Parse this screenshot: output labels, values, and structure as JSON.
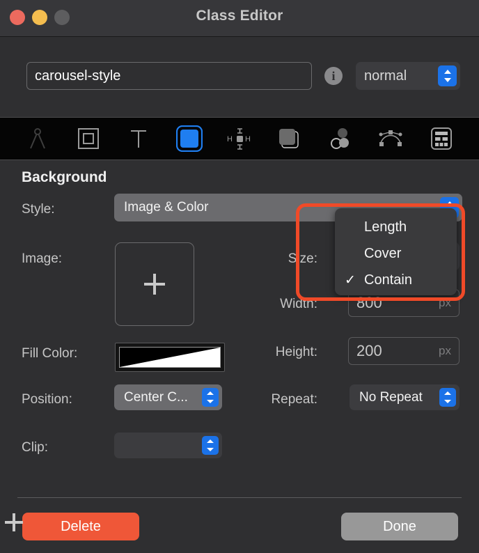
{
  "window": {
    "title": "Class Editor",
    "traffic_lights": [
      "close-button",
      "minimize-button",
      "zoom-button"
    ]
  },
  "name_row": {
    "class_name_value": "carousel-style",
    "class_name_placeholder": "",
    "info_icon": "info-icon",
    "state_value": "normal"
  },
  "toolbar": {
    "items": [
      {
        "name": "layout-compass-icon",
        "selected": false
      },
      {
        "name": "border-box-icon",
        "selected": false
      },
      {
        "name": "typography-icon",
        "selected": false
      },
      {
        "name": "background-fill-icon",
        "selected": true
      },
      {
        "name": "spacing-margins-icon",
        "selected": false
      },
      {
        "name": "shadow-layers-icon",
        "selected": false
      },
      {
        "name": "effects-blend-icon",
        "selected": false
      },
      {
        "name": "transition-curve-icon",
        "selected": false
      },
      {
        "name": "grid-table-icon",
        "selected": false
      }
    ]
  },
  "background": {
    "section_title": "Background",
    "style_label": "Style:",
    "style_value": "Image & Color",
    "image_label": "Image:",
    "image_add_glyph": "plus-icon",
    "fill_color_label": "Fill Color:",
    "fill_color_swatch": "black-to-white-diagonal",
    "position_label": "Position:",
    "position_value": "Center C...",
    "clip_label": "Clip:",
    "clip_value": "",
    "size_label": "Size:",
    "width_label": "Width:",
    "width_value": "800",
    "width_unit": "px",
    "height_label": "Height:",
    "height_value": "200",
    "height_unit": "px",
    "repeat_label": "Repeat:",
    "repeat_value": "No Repeat"
  },
  "size_popup": {
    "highlighted": true,
    "highlight_color": "#f04a28",
    "checkmark": "✓",
    "options": [
      {
        "label": "Length",
        "checked": false
      },
      {
        "label": "Cover",
        "checked": false
      },
      {
        "label": "Contain",
        "checked": true
      }
    ]
  },
  "footer": {
    "delete_label": "Delete",
    "add_glyph": "plus-icon",
    "done_label": "Done"
  },
  "colors": {
    "accent_blue": "#1b72e8",
    "delete_red": "#ef5738",
    "highlight_orange": "#f04a28",
    "window_bg": "#2f2f31",
    "toolbar_bg": "#050505"
  }
}
